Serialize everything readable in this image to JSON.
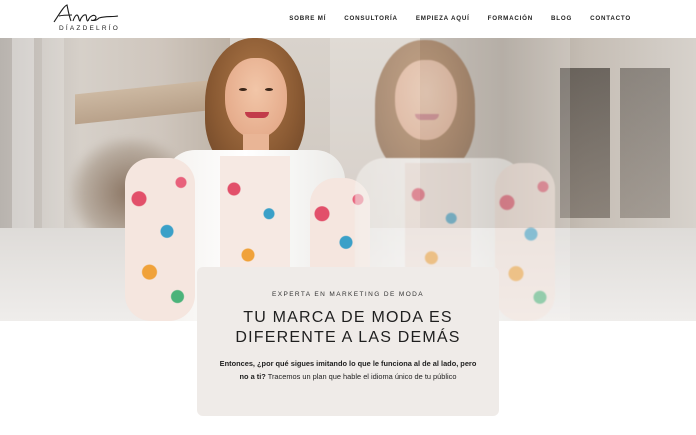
{
  "logo": {
    "script": "Ana",
    "subtitle": "DÍAZDELRÍO"
  },
  "nav": {
    "items": [
      "SOBRE MÍ",
      "CONSULTORÍA",
      "EMPIEZA AQUÍ",
      "FORMACIÓN",
      "BLOG",
      "CONTACTO"
    ]
  },
  "hero": {
    "eyebrow": "EXPERTA EN MARKETING DE MODA",
    "headline_line1": "TU MARCA DE MODA ES",
    "headline_line2": "DIFERENTE A LAS DEMÁS",
    "body_bold": "Entonces, ¿por qué sigues imitando lo que le funciona al de al lado, pero no a ti?",
    "body_regular": "Tracemos un plan que hable el idioma único de tu público"
  },
  "colors": {
    "card_bg": "#efebe8",
    "text": "#1f1f1f",
    "header_bg": "#ffffff"
  }
}
